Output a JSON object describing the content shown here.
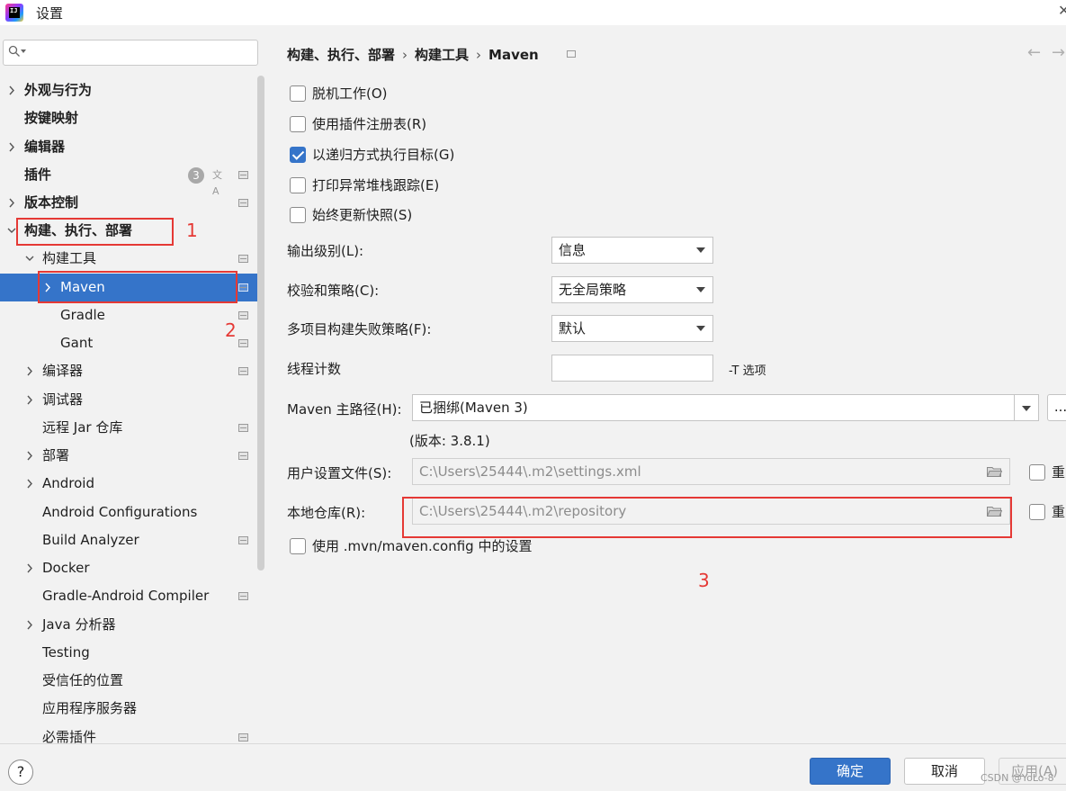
{
  "window": {
    "title": "设置"
  },
  "search": {
    "placeholder": ""
  },
  "sidebar": {
    "items": [
      {
        "label": "外观与行为",
        "expandable": true,
        "bold": true
      },
      {
        "label": "按键映射",
        "bold": true
      },
      {
        "label": "编辑器",
        "expandable": true,
        "bold": true
      },
      {
        "label": "插件",
        "bold": true,
        "badge": "3"
      },
      {
        "label": "版本控制",
        "expandable": true,
        "bold": true
      },
      {
        "label": "构建、执行、部署",
        "expanded": true,
        "bold": true
      },
      {
        "label": "构建工具",
        "expanded": true
      },
      {
        "label": "Maven",
        "expandable": true,
        "selected": true
      },
      {
        "label": "Gradle"
      },
      {
        "label": "Gant"
      },
      {
        "label": "编译器",
        "expandable": true
      },
      {
        "label": "调试器",
        "expandable": true
      },
      {
        "label": "远程 Jar 仓库"
      },
      {
        "label": "部署",
        "expandable": true
      },
      {
        "label": "Android",
        "expandable": true
      },
      {
        "label": "Android Configurations"
      },
      {
        "label": "Build Analyzer"
      },
      {
        "label": "Docker",
        "expandable": true
      },
      {
        "label": "Gradle-Android Compiler"
      },
      {
        "label": "Java 分析器",
        "expandable": true
      },
      {
        "label": "Testing"
      },
      {
        "label": "受信任的位置"
      },
      {
        "label": "应用程序服务器"
      },
      {
        "label": "必需插件"
      }
    ]
  },
  "annotations": {
    "n1": "1",
    "n2": "2",
    "n3": "3"
  },
  "breadcrumb": {
    "part1": "构建、执行、部署",
    "part2": "构建工具",
    "part3": "Maven",
    "sep": "›"
  },
  "nav": {
    "back": "←",
    "forward": "→"
  },
  "options": {
    "offline": "脱机工作(O)",
    "plugin_registry": "使用插件注册表(R)",
    "recursive": "以递归方式执行目标(G)",
    "print_stack": "打印异常堆栈跟踪(E)",
    "always_update": "始终更新快照(S)",
    "use_mvn_config": "使用 .mvn/maven.config 中的设置"
  },
  "form": {
    "output_level_label": "输出级别(L):",
    "output_level_value": "信息",
    "checksum_label": "校验和策略(C):",
    "checksum_value": "无全局策略",
    "multiproject_label": "多项目构建失败策略(F):",
    "multiproject_value": "默认",
    "threads_label": "线程计数",
    "threads_value": "",
    "threads_hint": "-T 选项",
    "maven_home_label": "Maven 主路径(H):",
    "maven_home_value": "已捆绑(Maven 3)",
    "browse_label": "...",
    "version_text": "(版本: 3.8.1)",
    "user_settings_label": "用户设置文件(S):",
    "user_settings_value": "C:\\Users\\25444\\.m2\\settings.xml",
    "override_label": "重",
    "local_repo_label": "本地仓库(R):",
    "local_repo_value": "C:\\Users\\25444\\.m2\\repository",
    "override2_label": "重"
  },
  "footer": {
    "help": "?",
    "ok": "确定",
    "cancel": "取消",
    "apply": "应用(A)",
    "watermark": "CSDN @YoLo-8"
  },
  "colors": {
    "accent": "#3574c9",
    "annotation": "#e53935"
  }
}
